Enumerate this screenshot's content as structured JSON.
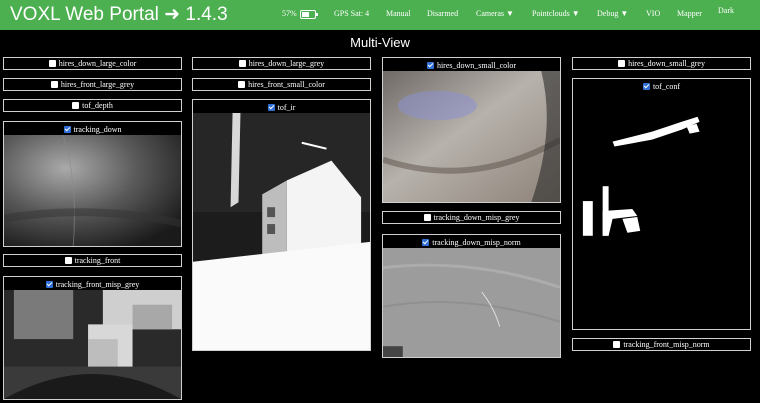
{
  "header": {
    "brand": "VOXL Web Portal ➜ 1.4.3",
    "battery": "57%",
    "battery_level": 0.57,
    "gps": "GPS Sat: 4",
    "mode": "Manual",
    "arm_state": "Disarmed",
    "menus": [
      "Cameras ▼",
      "Pointclouds ▼",
      "Debug ▼",
      "VIO",
      "Mapper",
      "Dark"
    ]
  },
  "title": "Multi-View",
  "cameras": {
    "hires_down_large_color": "hires_down_large_color",
    "hires_front_large_grey": "hires_front_large_grey",
    "tof_depth": "tof_depth",
    "tracking_down": "tracking_down",
    "tracking_front": "tracking_front",
    "tracking_front_misp_grey": "tracking_front_misp_grey",
    "hires_down_large_grey": "hires_down_large_grey",
    "hires_front_small_color": "hires_front_small_color",
    "tof_ir": "tof_ir",
    "hires_down_small_color": "hires_down_small_color",
    "tracking_down_misp_grey": "tracking_down_misp_grey",
    "tracking_down_misp_norm": "tracking_down_misp_norm",
    "hires_down_small_grey": "hires_down_small_grey",
    "tof_conf": "tof_conf",
    "tracking_front_misp_norm": "tracking_front_misp_norm"
  },
  "colors": {
    "header_bg": "#4caf50",
    "page_bg": "#000000",
    "checkbox_on": "#2f6fd6"
  }
}
